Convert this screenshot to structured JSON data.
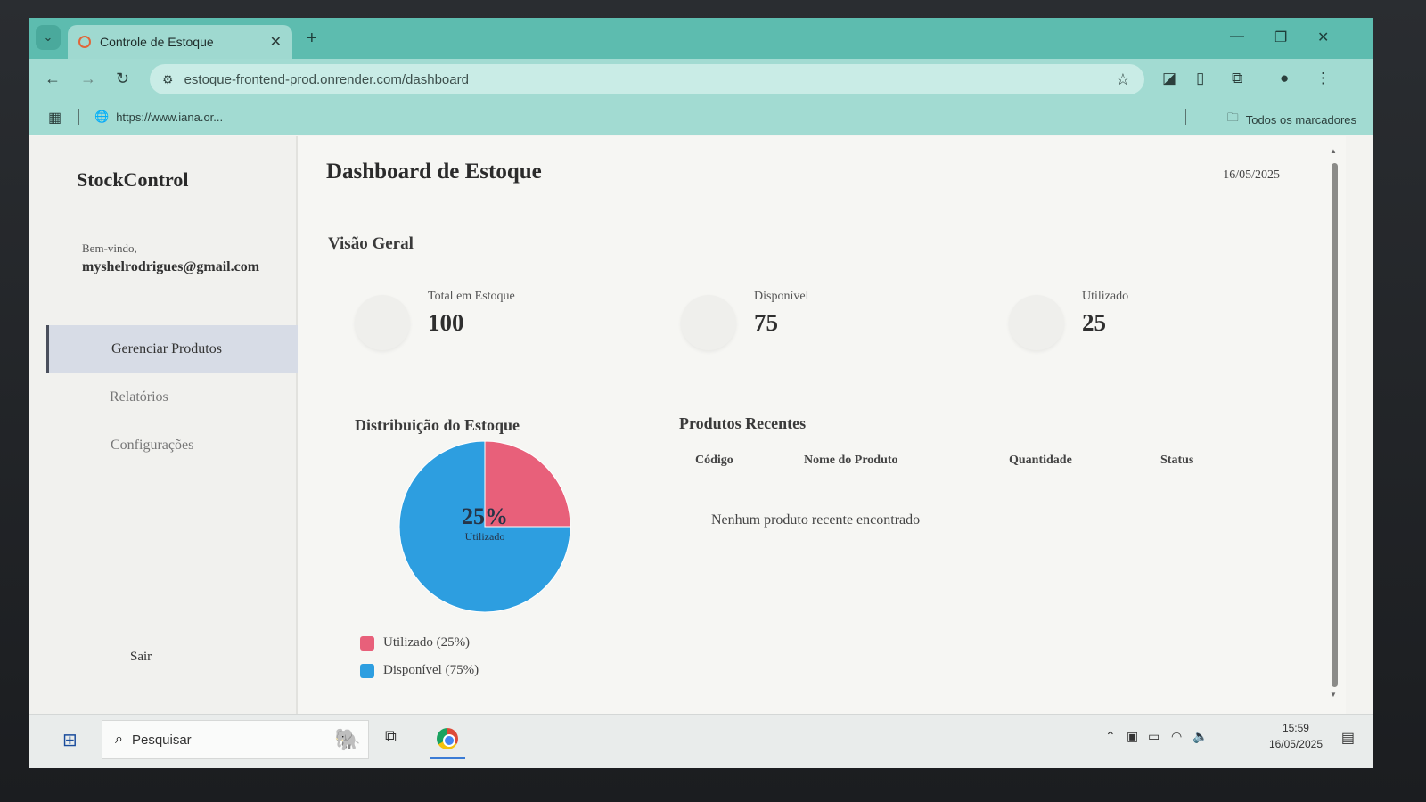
{
  "browser": {
    "tab_title": "Controle de Estoque",
    "url": "estoque-frontend-prod.onrender.com/dashboard",
    "bookmark_item": "https://www.iana.or...",
    "bookmarks_all": "Todos os marcadores"
  },
  "sidebar": {
    "brand": "StockControl",
    "welcome": "Bem-vindo,",
    "user_email": "myshelrodrigues@gmail.com",
    "items": [
      {
        "label": "Gerenciar Produtos",
        "active": true
      },
      {
        "label": "Relatórios",
        "active": false
      },
      {
        "label": "Configurações",
        "active": false
      }
    ],
    "logout": "Sair"
  },
  "main": {
    "title": "Dashboard de Estoque",
    "date": "16/05/2025",
    "overview_title": "Visão Geral",
    "stats": [
      {
        "label": "Total em Estoque",
        "value": "100"
      },
      {
        "label": "Disponível",
        "value": "75"
      },
      {
        "label": "Utilizado",
        "value": "25"
      }
    ],
    "distribution_title": "Distribuição do Estoque",
    "pie_center_value": "25%",
    "pie_center_label": "Utilizado",
    "legend": [
      {
        "label": "Utilizado (25%)",
        "color": "#e8607a"
      },
      {
        "label": "Disponível (75%)",
        "color": "#2d9ee0"
      }
    ],
    "recent_title": "Produtos Recentes",
    "table_headers": [
      "Código",
      "Nome do Produto",
      "Quantidade",
      "Status"
    ],
    "empty_message": "Nenhum produto recente encontrado"
  },
  "chart_data": {
    "type": "pie",
    "categories": [
      "Utilizado",
      "Disponível"
    ],
    "values": [
      25,
      75
    ],
    "colors": [
      "#e8607a",
      "#2d9ee0"
    ]
  },
  "taskbar": {
    "search_placeholder": "Pesquisar",
    "time": "15:59",
    "date": "16/05/2025"
  }
}
